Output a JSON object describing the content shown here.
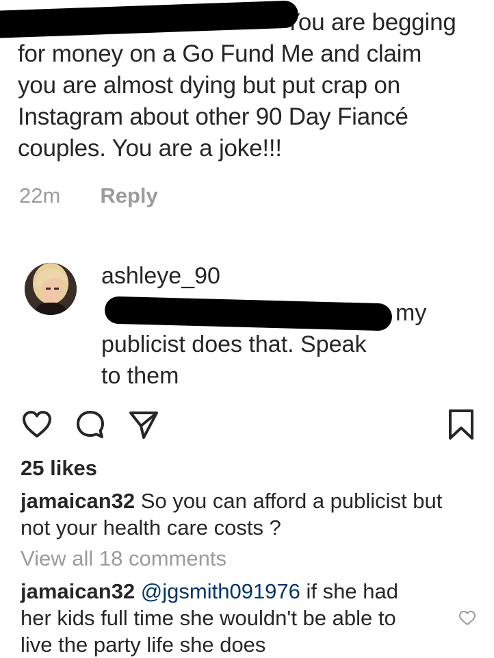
{
  "top_comment": {
    "lines": [
      "You are begging",
      "for money on a Go Fund Me and claim",
      "you are almost dying but put crap on",
      "Instagram about other 90 Day Fiancé",
      "couples.  You are a joke!!!"
    ],
    "time": "22m",
    "reply_label": "Reply"
  },
  "reply_comment": {
    "username": "ashleye_90",
    "lines": [
      "my",
      "publicist does that. Speak",
      "to them"
    ]
  },
  "actions": {
    "like_icon": "heart-icon",
    "comment_icon": "comment-bubble-icon",
    "share_icon": "paper-plane-icon",
    "save_icon": "bookmark-icon"
  },
  "likes_text": "25 likes",
  "comments": [
    {
      "username": "jamaican32",
      "text": " So you can afford a publicist but not your health care costs ?"
    },
    {
      "username": "jamaican32",
      "mention": "@jgsmith091976",
      "text": " if she had her kids full time she wouldn't be able to live the party life she does"
    }
  ],
  "view_all_text": "View all 18 comments",
  "colors": {
    "text": "#262626",
    "muted": "#9b9b9b",
    "mention": "#003569",
    "redaction": "#000000"
  }
}
